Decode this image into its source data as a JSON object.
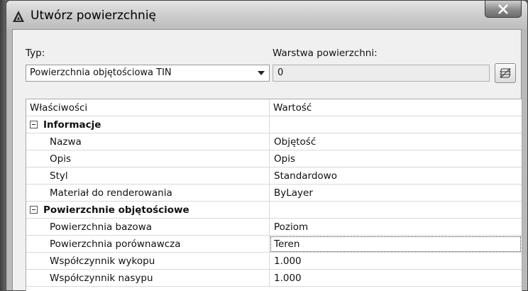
{
  "window": {
    "title": "Utwórz powierzchnię",
    "close_label": "X"
  },
  "form": {
    "type_label": "Typ:",
    "type_value": "Powierzchnia objętościowa TIN",
    "layer_label": "Warstwa powierzchni:",
    "layer_value": "0"
  },
  "grid": {
    "col_property": "Właściwości",
    "col_value": "Wartość",
    "categories": [
      {
        "name": "Informacje",
        "rows": [
          {
            "property": "Nazwa",
            "value": "Objętość"
          },
          {
            "property": "Opis",
            "value": "Opis"
          },
          {
            "property": "Styl",
            "value": "Standardowo"
          },
          {
            "property": "Materiał do renderowania",
            "value": "ByLayer"
          }
        ]
      },
      {
        "name": "Powierzchnie objętościowe",
        "rows": [
          {
            "property": "Powierzchnia bazowa",
            "value": "Poziom"
          },
          {
            "property": "Powierzchnia porównawcza",
            "value": "Teren"
          },
          {
            "property": "Współczynnik wykopu",
            "value": "1.000"
          },
          {
            "property": "Współczynnik nasypu",
            "value": "1.000"
          }
        ]
      }
    ]
  }
}
